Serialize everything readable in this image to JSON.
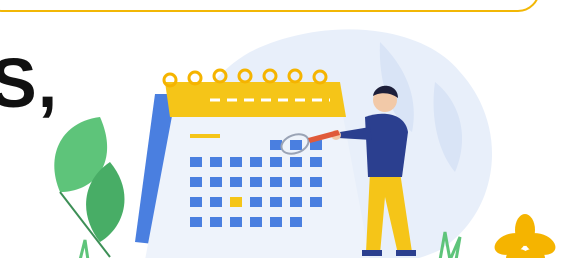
{
  "banner": {
    "accent_color": "#f2b705"
  },
  "heading": {
    "fragment": "S,"
  },
  "illustration": {
    "subject": "person-marking-calendar",
    "calendar_header_color": "#f5c518",
    "calendar_body_color": "#eef3fb",
    "day_cell_color": "#4a7fe0",
    "highlight_cell_color": "#f5c518",
    "leaf_color": "#5ec47a",
    "backdrop_color": "#e8effa",
    "person_shirt_color": "#2b3f8f",
    "person_pants_color": "#f5c518"
  },
  "decoration": {
    "flower_color": "#f5b400"
  }
}
